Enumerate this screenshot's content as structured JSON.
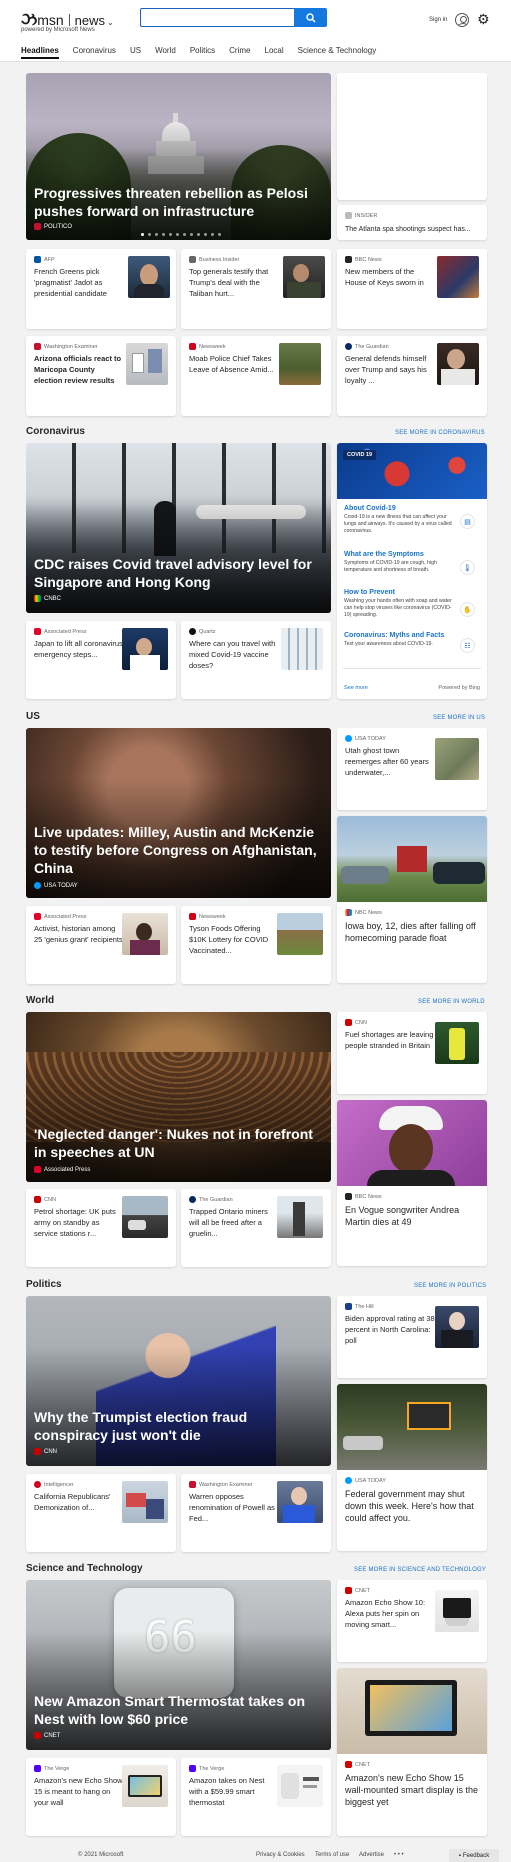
{
  "header": {
    "logo_msn": "msn",
    "logo_news": "news",
    "powered_by": "powered by Microsoft News",
    "search_placeholder": "",
    "sign_in": "Sign in"
  },
  "nav": [
    "Headlines",
    "Coronavirus",
    "US",
    "World",
    "Politics",
    "Crime",
    "Local",
    "Science & Technology"
  ],
  "headlines": {
    "hero": {
      "title": "Progressives threaten rebellion as Pelosi pushes forward on infrastructure",
      "source": "POLITICO",
      "source_color": "#c8102e"
    },
    "side_text": {
      "source": "INSIDER",
      "title": "The Atlanta spa shootings suspect has..."
    },
    "cards": [
      {
        "source": "AFP",
        "title": "French Greens pick 'pragmatist' Jadot as presidential candidate",
        "color": "#0055a4"
      },
      {
        "source": "Business Insider",
        "title": "Top generals testify that Trump's deal with the Taliban hurt...",
        "color": "#666666"
      },
      {
        "source": "BBC News",
        "title": "New members of the House of Keys sworn in",
        "color": "#222222"
      },
      {
        "source": "Washington Examiner",
        "title": "Arizona officials react to Maricopa County election review results",
        "color": "#c8102e"
      },
      {
        "source": "Newsweek",
        "title": "Moab Police Chief Takes Leave of Absence Amid...",
        "color": "#d0021b"
      },
      {
        "source": "The Guardian",
        "title": "General defends himself over Trump and says his loyalty ...",
        "color": "#052962"
      }
    ]
  },
  "coronavirus": {
    "title": "Coronavirus",
    "more": "SEE MORE IN CORONAVIRUS",
    "hero": {
      "title": "CDC raises Covid travel advisory level for Singapore and Hong Kong",
      "source": "CNBC"
    },
    "panel": {
      "badge": "COVID 19",
      "items": [
        {
          "title": "About Covid-19",
          "desc": "Covid-19 is a new illness that can affect your lungs and airways. It's caused by a virus called coronavirus."
        },
        {
          "title": "What are the Symptoms",
          "desc": "Symptoms of COVID-19 are cough, high temperature and shortness of breath."
        },
        {
          "title": "How to Prevent",
          "desc": "Washing your hands often with soap and water can help stop viruses like coronavirus (COVID-19) spreading."
        },
        {
          "title": "Coronavirus: Myths and Facts",
          "desc": "Test your awareness about COVID-19."
        }
      ],
      "see_more": "See more",
      "powered": "Powered by Bing"
    },
    "cards": [
      {
        "source": "Associated Press",
        "title": "Japan to lift all coronavirus emergency steps...",
        "color": "#e4002b"
      },
      {
        "source": "Quartz",
        "title": "Where can you travel with mixed Covid-19 vaccine doses?",
        "color": "#111111"
      }
    ]
  },
  "us": {
    "title": "US",
    "more": "SEE MORE IN US",
    "hero": {
      "title": "Live updates: Milley, Austin and McKenzie to testify before Congress on Afghanistan, China",
      "source": "USA TODAY"
    },
    "side_small": {
      "source": "USA TODAY",
      "title": "Utah ghost town reemerges after 60 years underwater,..."
    },
    "side_big": {
      "source": "NBC News",
      "title": "Iowa boy, 12, dies after falling off homecoming parade float"
    },
    "cards": [
      {
        "source": "Associated Press",
        "title": "Activist, historian among 25 'genius grant' recipients",
        "color": "#e4002b"
      },
      {
        "source": "Newsweek",
        "title": "Tyson Foods Offering $10K Lottery for COVID Vaccinated...",
        "color": "#d0021b"
      }
    ]
  },
  "world": {
    "title": "World",
    "more": "SEE MORE IN WORLD",
    "hero": {
      "title": "'Neglected danger': Nukes not in forefront in speeches at UN",
      "source": "Associated Press"
    },
    "side_small": {
      "source": "CNN",
      "title": "Fuel shortages are leaving people stranded in Britain"
    },
    "side_big": {
      "source": "BBC News",
      "title": "En Vogue songwriter Andrea Martin dies at 49"
    },
    "cards": [
      {
        "source": "CNN",
        "title": "Petrol shortage: UK puts army on standby as service stations r...",
        "color": "#cc0000"
      },
      {
        "source": "The Guardian",
        "title": "Trapped Ontario miners will all be freed after a gruelin...",
        "color": "#052962"
      }
    ]
  },
  "politics": {
    "title": "Politics",
    "more": "SEE MORE IN POLITICS",
    "hero": {
      "title": "Why the Trumpist election fraud conspiracy just won't die",
      "source": "CNN"
    },
    "side_small": {
      "source": "The Hill",
      "title": "Biden approval rating at 38 percent in North Carolina: poll"
    },
    "side_big": {
      "source": "USA TODAY",
      "title": "Federal government may shut down this week. Here's how that could affect you."
    },
    "cards": [
      {
        "source": "Intelligencer",
        "title": "California Republicans' Demonization of...",
        "color": "#d0021b"
      },
      {
        "source": "Washington Examiner",
        "title": "Warren opposes renomination of Powell as Fed...",
        "color": "#c8102e"
      }
    ]
  },
  "scitech": {
    "title": "Science and Technology",
    "more": "SEE MORE IN SCIENCE AND TECHNOLOGY",
    "hero": {
      "title": "New Amazon Smart Thermostat takes on Nest with low $60 price",
      "source": "CNET",
      "display": "66"
    },
    "side_small": {
      "source": "CNET",
      "title": "Amazon Echo Show 10: Alexa puts her spin on moving smart..."
    },
    "side_big": {
      "source": "CNET",
      "title": "Amazon's new Echo Show 15 wall-mounted smart display is the biggest yet"
    },
    "cards": [
      {
        "source": "The Verge",
        "title": "Amazon's new Echo Show 15 is meant to hang on your wall",
        "color": "#5200ff"
      },
      {
        "source": "The Verge",
        "title": "Amazon takes on Nest with a $59.99 smart thermostat",
        "color": "#5200ff"
      }
    ]
  },
  "footer": {
    "copyright": "© 2021 Microsoft",
    "privacy": "Privacy & Cookies",
    "terms": "Terms of use",
    "advertise": "Advertise",
    "dots": "• • •",
    "feedback": "Feedback"
  }
}
